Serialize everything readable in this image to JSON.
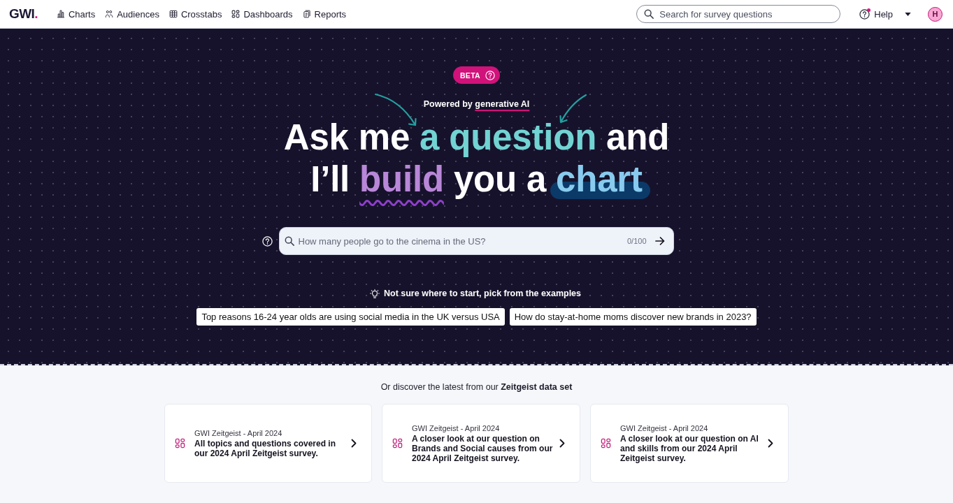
{
  "nav": {
    "logo": "GWI.",
    "items": [
      {
        "label": "Charts",
        "kind": "charts"
      },
      {
        "label": "Audiences",
        "kind": "audiences"
      },
      {
        "label": "Crosstabs",
        "kind": "crosstabs"
      },
      {
        "label": "Dashboards",
        "kind": "dashboards"
      },
      {
        "label": "Reports",
        "kind": "reports"
      }
    ],
    "search": {
      "placeholder": "Search for survey questions"
    },
    "help": {
      "label": "Help",
      "has_notification": true
    },
    "avatar": {
      "initial": "H"
    }
  },
  "hero": {
    "badge": "BETA",
    "powered_by": {
      "prefix": "Powered by",
      "highlight": "generative AI"
    },
    "headline": [
      [
        {
          "text": "Ask me",
          "kind": "plain"
        },
        {
          "text": "a question",
          "kind": "highlight"
        },
        {
          "text": "and",
          "kind": "plain"
        }
      ],
      [
        {
          "text": "I’ll",
          "kind": "plain"
        },
        {
          "text": "build",
          "kind": "squiggle"
        },
        {
          "text": "you a",
          "kind": "plain"
        },
        {
          "text": "chart",
          "kind": "marker"
        }
      ]
    ],
    "search": {
      "placeholder": "How many people go to the cinema in the US?",
      "counter": "0/100"
    },
    "examples_prompt": "Not sure where to start, pick from the examples",
    "examples": [
      "Top reasons 16-24 year olds are using social media in the UK versus USA",
      "How do stay-at-home moms discover new brands in 2023?"
    ]
  },
  "discover": {
    "intro": "Or discover the latest from our **Zeitgeist data set**",
    "cards": [
      {
        "eyebrow": "GWI Zeitgeist - April 2024",
        "title": "All topics and questions covered in our 2024 April Zeitgeist survey."
      },
      {
        "eyebrow": "GWI Zeitgeist - April 2024",
        "title": "A closer look at our question on Brands and Social causes from our 2024 April Zeitgeist survey."
      },
      {
        "eyebrow": "GWI Zeitgeist - April 2024",
        "title": "A closer look at our question on AI and skills from our 2024 April Zeitgeist survey."
      }
    ]
  }
}
